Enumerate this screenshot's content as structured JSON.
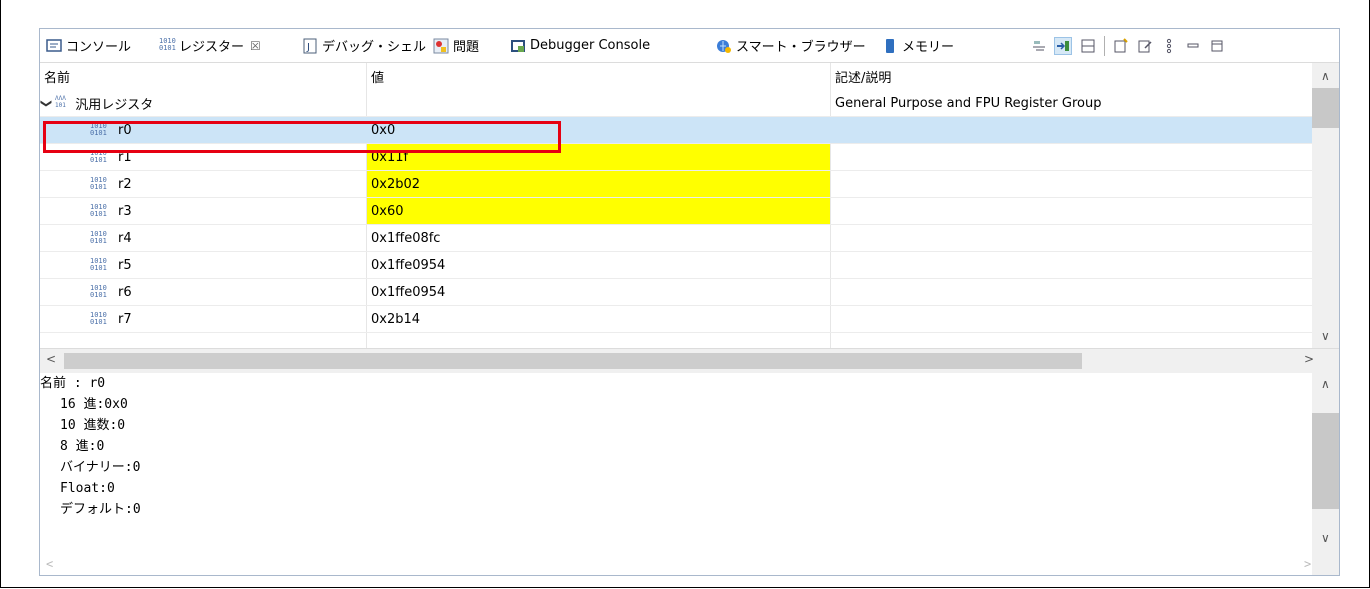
{
  "tabs": [
    {
      "label": "コンソール",
      "icon": "console-icon"
    },
    {
      "label": "レジスター",
      "icon": "register-icon",
      "active": true,
      "close": "☒"
    },
    {
      "label": "デバッグ・シェル",
      "icon": "debug-shell-icon"
    },
    {
      "label": "問題",
      "icon": "problems-icon"
    },
    {
      "label": "Debugger Console",
      "icon": "debugger-console-icon"
    },
    {
      "label": "スマート・ブラウザー",
      "icon": "smart-browser-icon"
    },
    {
      "label": "メモリー",
      "icon": "memory-icon"
    }
  ],
  "table": {
    "headers": {
      "name": "名前",
      "value": "値",
      "description": "記述/説明"
    },
    "group": {
      "label": "汎用レジスタ",
      "description": "General Purpose and FPU Register Group",
      "expanded": true
    },
    "rows": [
      {
        "name": "r0",
        "value": "0x0",
        "selected": true,
        "changed": false
      },
      {
        "name": "r1",
        "value": "0x11f",
        "selected": false,
        "changed": true
      },
      {
        "name": "r2",
        "value": "0x2b02",
        "selected": false,
        "changed": true
      },
      {
        "name": "r3",
        "value": "0x60",
        "selected": false,
        "changed": true
      },
      {
        "name": "r4",
        "value": "0x1ffe08fc",
        "selected": false,
        "changed": false
      },
      {
        "name": "r5",
        "value": "0x1ffe0954",
        "selected": false,
        "changed": false
      },
      {
        "name": "r6",
        "value": "0x1ffe0954",
        "selected": false,
        "changed": false
      },
      {
        "name": "r7",
        "value": "0x2b14",
        "selected": false,
        "changed": false
      }
    ],
    "bin_glyph_top": "1010",
    "bin_glyph_bottom": "0101"
  },
  "detail": {
    "name_line": "名前 : r0",
    "lines": [
      "16 進:0x0",
      "10 進数:0",
      "8 進:0",
      "バイナリー:0",
      "Float:0",
      "デフォルト:0"
    ]
  },
  "colors": {
    "changed": "#ffff00",
    "selected": "#cce4f7",
    "highlight_box": "#e60012"
  }
}
